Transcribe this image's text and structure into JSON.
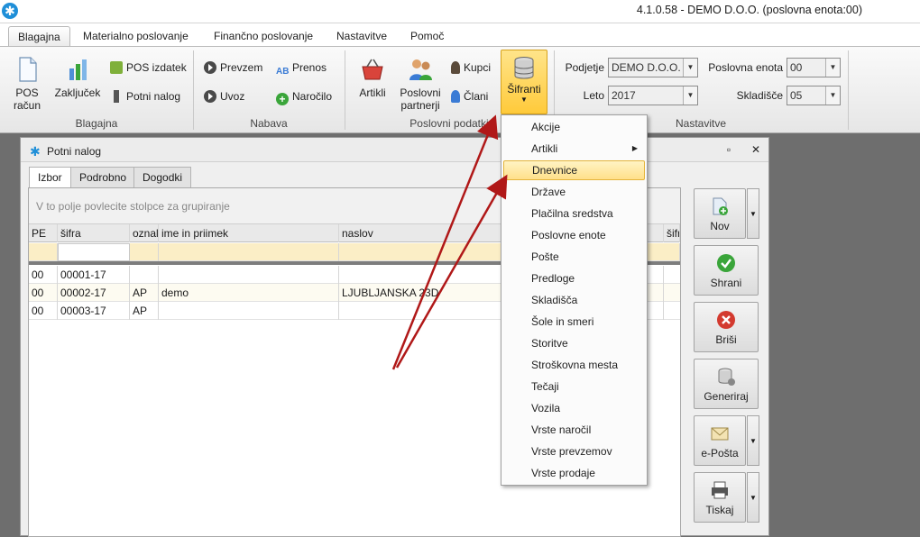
{
  "window": {
    "title": "4.1.0.58 - DEMO D.O.O. (poslovna enota:00)"
  },
  "ribbon_tabs": [
    {
      "label": "Blagajna",
      "active": true
    },
    {
      "label": "Materialno poslovanje"
    },
    {
      "label": "Finančno poslovanje"
    },
    {
      "label": "Nastavitve"
    },
    {
      "label": "Pomoč"
    }
  ],
  "ribbon": {
    "blagajna": {
      "label": "Blagajna",
      "pos_racun": "POS\nračun",
      "zakljucek": "Zaključek",
      "pos_izdatek": "POS izdatek",
      "potni_nalog": "Potni nalog"
    },
    "nabava": {
      "label": "Nabava",
      "prevzem": "Prevzem",
      "uvoz": "Uvoz",
      "prenos": "Prenos",
      "narocilo": "Naročilo"
    },
    "poslovni": {
      "label": "Poslovni podatki",
      "artikli": "Artikli",
      "poslovni_partnerji": "Poslovni\npartnerji",
      "kupci": "Kupci",
      "clani": "Člani",
      "sifranti": "Šifranti"
    },
    "nastavitve": {
      "label": "Nastavitve",
      "podjetje_label": "Podjetje",
      "podjetje_value": "DEMO D.O.O.",
      "leto_label": "Leto",
      "leto_value": "2017",
      "poslovna_enota_label": "Poslovna enota",
      "poslovna_enota_value": "00",
      "skladisce_label": "Skladišče",
      "skladisce_value": "05"
    }
  },
  "child_window": {
    "title": "Potni nalog",
    "tabs": [
      "Izbor",
      "Podrobno",
      "Dogodki"
    ],
    "group_hint": "V to polje povlecite stolpce za grupiranje",
    "columns": [
      "PE",
      "šifra",
      "oznal",
      "ime in priimek",
      "naslov",
      "šifr"
    ],
    "rows": [
      [
        "00",
        "00001-17",
        "",
        "",
        ""
      ],
      [
        "00",
        "00002-17",
        "AP",
        "demo",
        "LJUBLJANSKA 23D"
      ],
      [
        "00",
        "00003-17",
        "AP",
        "",
        ""
      ]
    ],
    "side_buttons": {
      "nov": "Nov",
      "shrani": "Shrani",
      "brisi": "Briši",
      "generiraj": "Generiraj",
      "eposta": "e-Pošta",
      "tiskaj": "Tiskaj"
    }
  },
  "menu": {
    "items": [
      "Akcije",
      "Artikli",
      "Dnevnice",
      "Države",
      "Plačilna sredstva",
      "Poslovne enote",
      "Pošte",
      "Predloge",
      "Skladišča",
      "Šole in smeri",
      "Storitve",
      "Stroškovna mesta",
      "Tečaji",
      "Vozila",
      "Vrste naročil",
      "Vrste prevzemov",
      "Vrste prodaje"
    ],
    "highlighted": "Dnevnice"
  },
  "colors": {
    "accent": "#ffca3a",
    "highlight_border": "#e4b43a",
    "arrow": "#b01818",
    "app_blue": "#1f8fd8"
  }
}
